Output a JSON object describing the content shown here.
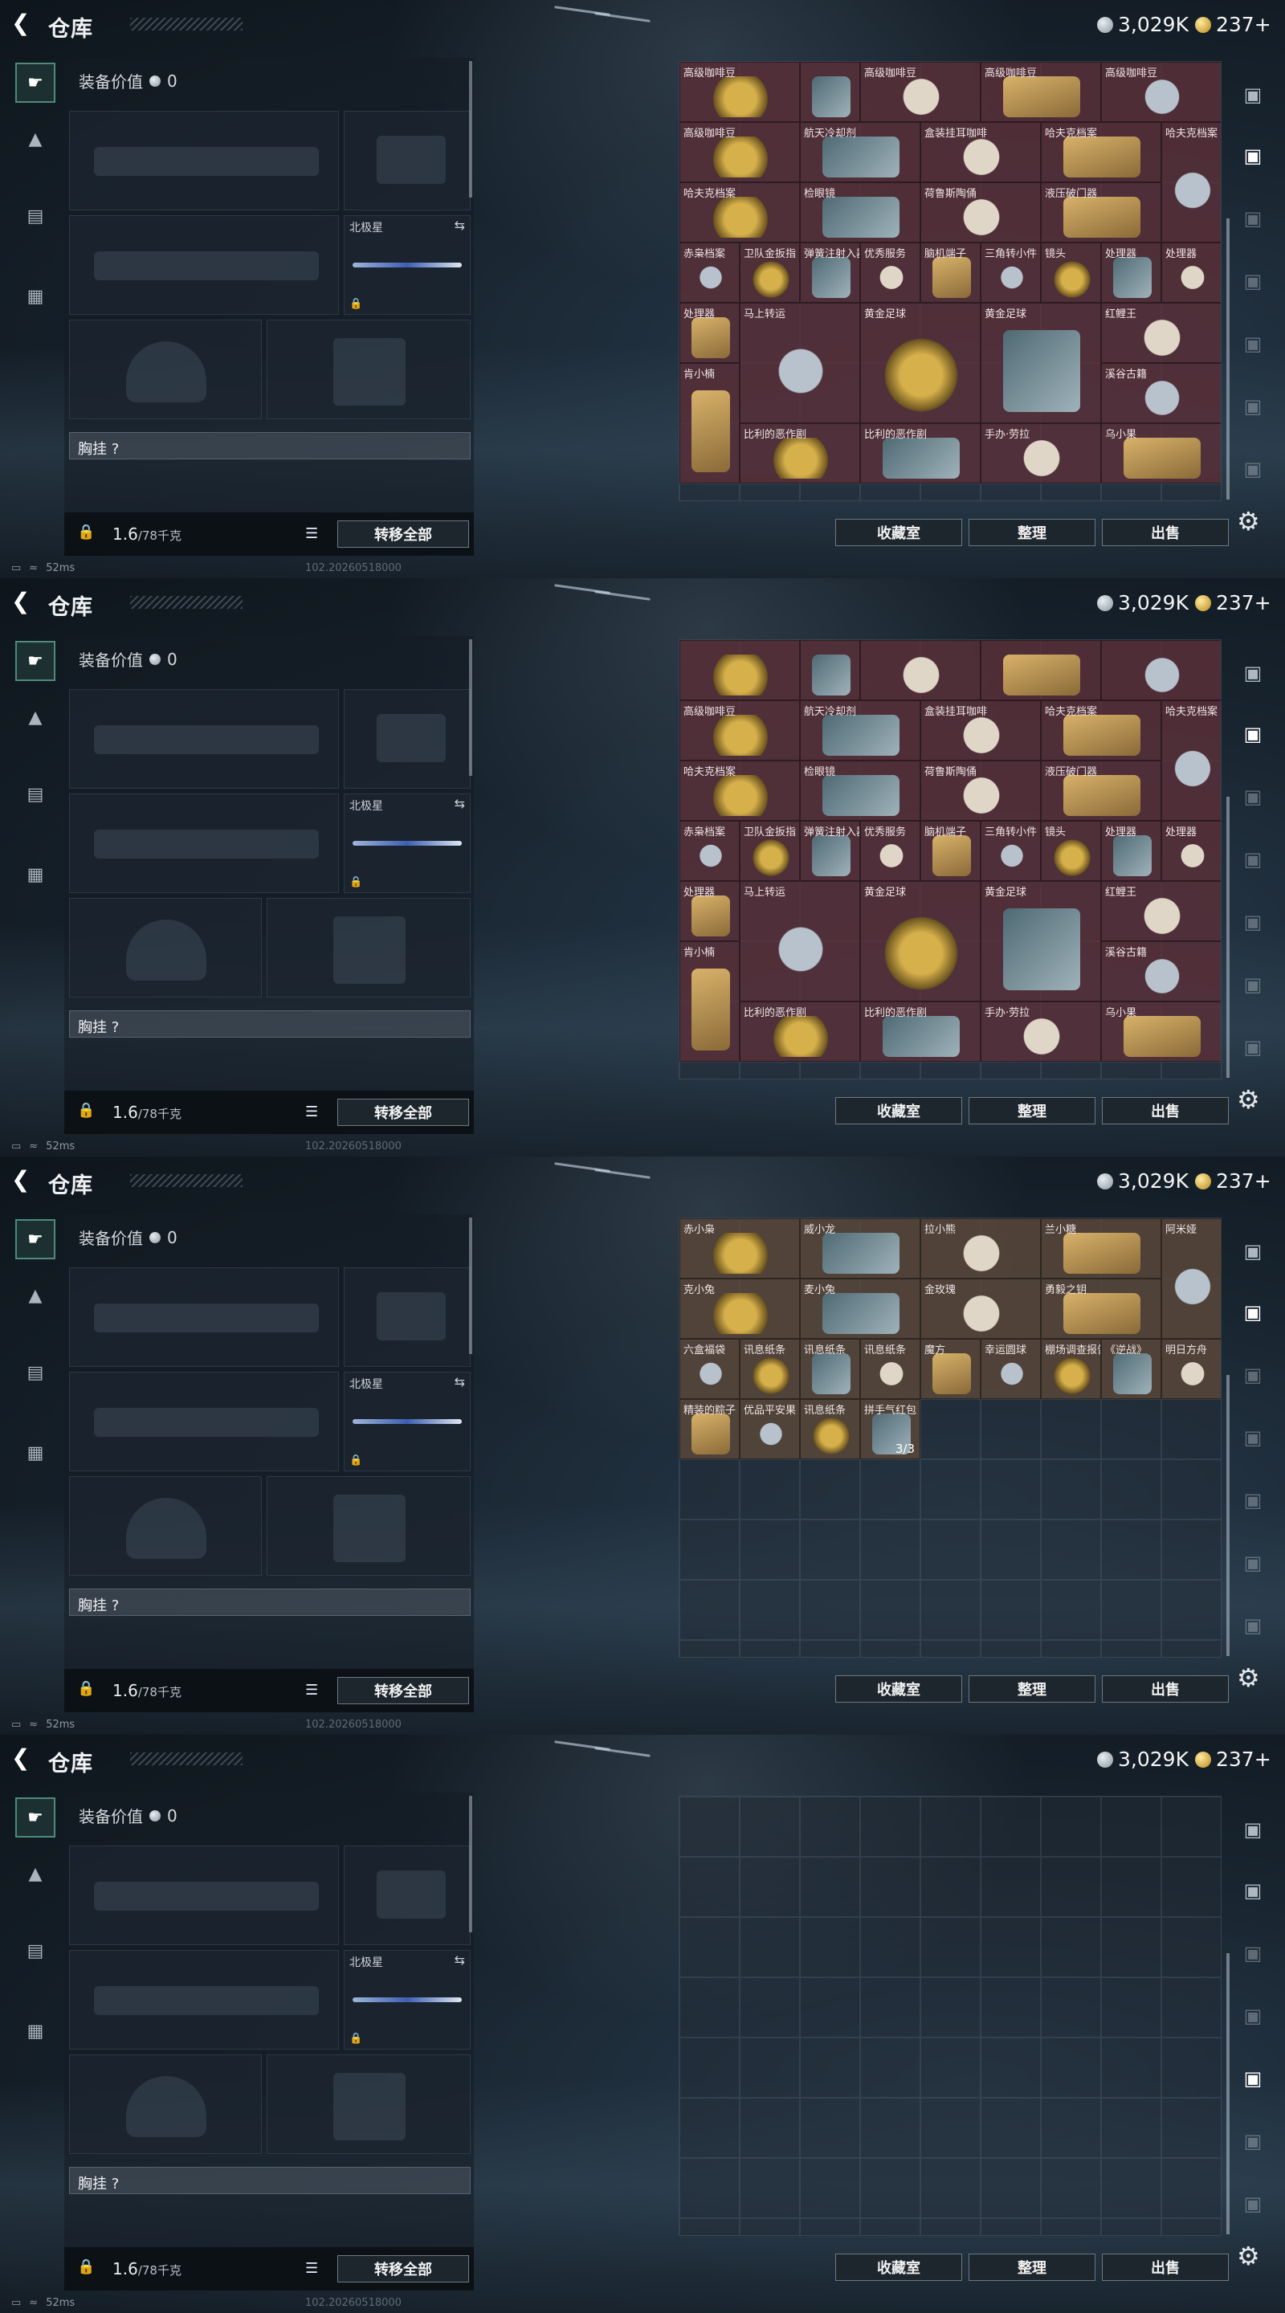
{
  "header": {
    "title": "仓库",
    "silver": "3,029K",
    "gold": "237+"
  },
  "left": {
    "equipment_value_label": "装备价值",
    "equipment_value": "0",
    "melee_label": "北极星",
    "chest_label": "胸挂 ?",
    "weight": "1.6",
    "weight_max": "/78千克",
    "transfer_all": "转移全部"
  },
  "actions": {
    "collection": "收藏室",
    "sort": "整理",
    "sell": "出售"
  },
  "status": {
    "ping": "52ms",
    "build": "102.20260518000"
  },
  "colors": {
    "item_red": "#5c3038",
    "item_brown": "#5c483a",
    "accent_green": "#4f8a7c"
  },
  "pages": [
    {
      "items": [
        {
          "name": "高级咖啡豆",
          "c": 0,
          "r": 0,
          "w": 2,
          "h": 1
        },
        {
          "name": "",
          "c": 2,
          "r": 0,
          "w": 1,
          "h": 1
        },
        {
          "name": "高级咖啡豆",
          "c": 3,
          "r": 0,
          "w": 2,
          "h": 1
        },
        {
          "name": "高级咖啡豆",
          "c": 5,
          "r": 0,
          "w": 2,
          "h": 1
        },
        {
          "name": "高级咖啡豆",
          "c": 7,
          "r": 0,
          "w": 2,
          "h": 1
        },
        {
          "name": "高级咖啡豆",
          "c": 0,
          "r": 1,
          "w": 2,
          "h": 1
        },
        {
          "name": "航天冷却剂",
          "c": 2,
          "r": 1,
          "w": 2,
          "h": 1
        },
        {
          "name": "盒装挂耳咖啡",
          "c": 4,
          "r": 1,
          "w": 2,
          "h": 1
        },
        {
          "name": "哈夫克档案",
          "c": 6,
          "r": 1,
          "w": 2,
          "h": 1
        },
        {
          "name": "哈夫克档案",
          "c": 8,
          "r": 1,
          "w": 1,
          "h": 2
        },
        {
          "name": "哈夫克档案",
          "c": 0,
          "r": 2,
          "w": 2,
          "h": 1
        },
        {
          "name": "检眼镜",
          "c": 2,
          "r": 2,
          "w": 2,
          "h": 1
        },
        {
          "name": "荷鲁斯陶俑",
          "c": 4,
          "r": 2,
          "w": 2,
          "h": 1
        },
        {
          "name": "液压破门器",
          "c": 6,
          "r": 2,
          "w": 2,
          "h": 1
        },
        {
          "name": "赤枭档案",
          "c": 0,
          "r": 3,
          "w": 1,
          "h": 1
        },
        {
          "name": "卫队金扳指",
          "c": 1,
          "r": 3,
          "w": 1,
          "h": 1
        },
        {
          "name": "弹簧注射入器",
          "c": 2,
          "r": 3,
          "w": 1,
          "h": 1
        },
        {
          "name": "优秀服务",
          "c": 3,
          "r": 3,
          "w": 1,
          "h": 1
        },
        {
          "name": "脑机端子",
          "c": 4,
          "r": 3,
          "w": 1,
          "h": 1
        },
        {
          "name": "三角转小件",
          "c": 5,
          "r": 3,
          "w": 1,
          "h": 1
        },
        {
          "name": "镜头",
          "c": 6,
          "r": 3,
          "w": 1,
          "h": 1
        },
        {
          "name": "处理器",
          "c": 7,
          "r": 3,
          "w": 1,
          "h": 1
        },
        {
          "name": "处理器",
          "c": 8,
          "r": 3,
          "w": 1,
          "h": 1
        },
        {
          "name": "处理器",
          "c": 0,
          "r": 4,
          "w": 1,
          "h": 1
        },
        {
          "name": "马上转运",
          "c": 1,
          "r": 4,
          "w": 2,
          "h": 2
        },
        {
          "name": "黄金足球",
          "c": 3,
          "r": 4,
          "w": 2,
          "h": 2
        },
        {
          "name": "黄金足球",
          "c": 5,
          "r": 4,
          "w": 2,
          "h": 2
        },
        {
          "name": "红鲤王",
          "c": 7,
          "r": 4,
          "w": 2,
          "h": 1
        },
        {
          "name": "肯小楠",
          "c": 0,
          "r": 5,
          "w": 1,
          "h": 2
        },
        {
          "name": "溪谷古籍",
          "c": 7,
          "r": 5,
          "w": 2,
          "h": 1
        },
        {
          "name": "比利的恶作剧",
          "c": 1,
          "r": 6,
          "w": 2,
          "h": 1
        },
        {
          "name": "比利的恶作剧",
          "c": 3,
          "r": 6,
          "w": 2,
          "h": 1
        },
        {
          "name": "手办·劳拉",
          "c": 5,
          "r": 6,
          "w": 2,
          "h": 1
        },
        {
          "name": "乌小果",
          "c": 7,
          "r": 6,
          "w": 2,
          "h": 1
        }
      ]
    },
    {
      "items": [
        {
          "name": "",
          "c": 0,
          "r": 0,
          "w": 2,
          "h": 1
        },
        {
          "name": "",
          "c": 2,
          "r": 0,
          "w": 1,
          "h": 1
        },
        {
          "name": "",
          "c": 3,
          "r": 0,
          "w": 2,
          "h": 1
        },
        {
          "name": "",
          "c": 5,
          "r": 0,
          "w": 2,
          "h": 1
        },
        {
          "name": "",
          "c": 7,
          "r": 0,
          "w": 2,
          "h": 1
        },
        {
          "name": "高级咖啡豆",
          "c": 0,
          "r": 1,
          "w": 2,
          "h": 1
        },
        {
          "name": "航天冷却剂",
          "c": 2,
          "r": 1,
          "w": 2,
          "h": 1
        },
        {
          "name": "盒装挂耳咖啡",
          "c": 4,
          "r": 1,
          "w": 2,
          "h": 1
        },
        {
          "name": "哈夫克档案",
          "c": 6,
          "r": 1,
          "w": 2,
          "h": 1
        },
        {
          "name": "哈夫克档案",
          "c": 8,
          "r": 1,
          "w": 1,
          "h": 2
        },
        {
          "name": "哈夫克档案",
          "c": 0,
          "r": 2,
          "w": 2,
          "h": 1
        },
        {
          "name": "检眼镜",
          "c": 2,
          "r": 2,
          "w": 2,
          "h": 1
        },
        {
          "name": "荷鲁斯陶俑",
          "c": 4,
          "r": 2,
          "w": 2,
          "h": 1
        },
        {
          "name": "液压破门器",
          "c": 6,
          "r": 2,
          "w": 2,
          "h": 1
        },
        {
          "name": "赤枭档案",
          "c": 0,
          "r": 3,
          "w": 1,
          "h": 1
        },
        {
          "name": "卫队金扳指",
          "c": 1,
          "r": 3,
          "w": 1,
          "h": 1
        },
        {
          "name": "弹簧注射入器",
          "c": 2,
          "r": 3,
          "w": 1,
          "h": 1
        },
        {
          "name": "优秀服务",
          "c": 3,
          "r": 3,
          "w": 1,
          "h": 1
        },
        {
          "name": "脑机端子",
          "c": 4,
          "r": 3,
          "w": 1,
          "h": 1
        },
        {
          "name": "三角转小件",
          "c": 5,
          "r": 3,
          "w": 1,
          "h": 1
        },
        {
          "name": "镜头",
          "c": 6,
          "r": 3,
          "w": 1,
          "h": 1
        },
        {
          "name": "处理器",
          "c": 7,
          "r": 3,
          "w": 1,
          "h": 1
        },
        {
          "name": "处理器",
          "c": 8,
          "r": 3,
          "w": 1,
          "h": 1
        },
        {
          "name": "处理器",
          "c": 0,
          "r": 4,
          "w": 1,
          "h": 1
        },
        {
          "name": "马上转运",
          "c": 1,
          "r": 4,
          "w": 2,
          "h": 2
        },
        {
          "name": "黄金足球",
          "c": 3,
          "r": 4,
          "w": 2,
          "h": 2
        },
        {
          "name": "黄金足球",
          "c": 5,
          "r": 4,
          "w": 2,
          "h": 2
        },
        {
          "name": "红鲤王",
          "c": 7,
          "r": 4,
          "w": 2,
          "h": 1
        },
        {
          "name": "肯小楠",
          "c": 0,
          "r": 5,
          "w": 1,
          "h": 2
        },
        {
          "name": "溪谷古籍",
          "c": 7,
          "r": 5,
          "w": 2,
          "h": 1
        },
        {
          "name": "比利的恶作剧",
          "c": 1,
          "r": 6,
          "w": 2,
          "h": 1
        },
        {
          "name": "比利的恶作剧",
          "c": 3,
          "r": 6,
          "w": 2,
          "h": 1
        },
        {
          "name": "手办·劳拉",
          "c": 5,
          "r": 6,
          "w": 2,
          "h": 1
        },
        {
          "name": "乌小果",
          "c": 7,
          "r": 6,
          "w": 2,
          "h": 1
        }
      ]
    },
    {
      "items": [
        {
          "name": "赤小枭",
          "c": 0,
          "r": 0,
          "w": 2,
          "h": 1,
          "brown": true
        },
        {
          "name": "威小龙",
          "c": 2,
          "r": 0,
          "w": 2,
          "h": 1,
          "brown": true
        },
        {
          "name": "拉小熊",
          "c": 4,
          "r": 0,
          "w": 2,
          "h": 1,
          "brown": true
        },
        {
          "name": "兰小糖",
          "c": 6,
          "r": 0,
          "w": 2,
          "h": 1,
          "brown": true
        },
        {
          "name": "阿米娅",
          "c": 8,
          "r": 0,
          "w": 1,
          "h": 2,
          "brown": true
        },
        {
          "name": "克小兔",
          "c": 0,
          "r": 1,
          "w": 2,
          "h": 1,
          "brown": true
        },
        {
          "name": "麦小兔",
          "c": 2,
          "r": 1,
          "w": 2,
          "h": 1,
          "brown": true
        },
        {
          "name": "金玫瑰",
          "c": 4,
          "r": 1,
          "w": 2,
          "h": 1,
          "brown": true
        },
        {
          "name": "勇毅之钥",
          "c": 6,
          "r": 1,
          "w": 2,
          "h": 1,
          "brown": true
        },
        {
          "name": "六盒福袋",
          "c": 0,
          "r": 2,
          "w": 1,
          "h": 1,
          "brown": true
        },
        {
          "name": "讯息纸条",
          "c": 1,
          "r": 2,
          "w": 1,
          "h": 1,
          "brown": true
        },
        {
          "name": "讯息纸条",
          "c": 2,
          "r": 2,
          "w": 1,
          "h": 1,
          "brown": true
        },
        {
          "name": "讯息纸条",
          "c": 3,
          "r": 2,
          "w": 1,
          "h": 1,
          "brown": true
        },
        {
          "name": "魔方",
          "c": 4,
          "r": 2,
          "w": 1,
          "h": 1,
          "brown": true
        },
        {
          "name": "幸运圆球",
          "c": 5,
          "r": 2,
          "w": 1,
          "h": 1,
          "brown": true
        },
        {
          "name": "棚场调查报告",
          "c": 6,
          "r": 2,
          "w": 1,
          "h": 1,
          "brown": true
        },
        {
          "name": "《逆战》",
          "c": 7,
          "r": 2,
          "w": 1,
          "h": 1,
          "brown": true
        },
        {
          "name": "明日方舟",
          "c": 8,
          "r": 2,
          "w": 1,
          "h": 1,
          "brown": true
        },
        {
          "name": "精装的粽子",
          "c": 0,
          "r": 3,
          "w": 1,
          "h": 1,
          "brown": true
        },
        {
          "name": "优品平安果",
          "c": 1,
          "r": 3,
          "w": 1,
          "h": 1,
          "brown": true
        },
        {
          "name": "讯息纸条",
          "c": 2,
          "r": 3,
          "w": 1,
          "h": 1,
          "brown": true
        },
        {
          "name": "拼手气红包",
          "c": 3,
          "r": 3,
          "w": 1,
          "h": 1,
          "brown": true,
          "qty": "3/3"
        }
      ]
    },
    {
      "items": []
    }
  ]
}
